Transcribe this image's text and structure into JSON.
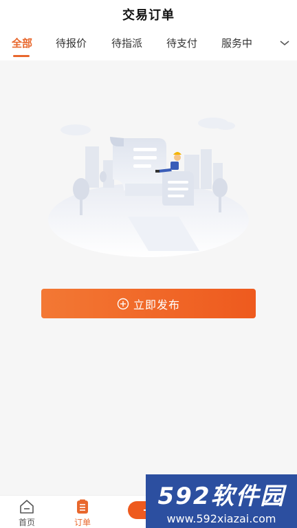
{
  "header": {
    "title": "交易订单"
  },
  "tabs": [
    {
      "label": "全部",
      "active": true
    },
    {
      "label": "待报价",
      "active": false
    },
    {
      "label": "待指派",
      "active": false
    },
    {
      "label": "待支付",
      "active": false
    },
    {
      "label": "服务中",
      "active": false
    }
  ],
  "tabs_more_icon": "chevron-down-icon",
  "empty_state": {
    "illustration": "empty-orders-illustration"
  },
  "publish_button": {
    "label": "立即发布",
    "icon": "plus-circle-icon"
  },
  "bottom_nav": [
    {
      "label": "首页",
      "icon": "home-icon",
      "active": false
    },
    {
      "label": "订单",
      "icon": "order-list-icon",
      "active": true
    }
  ],
  "watermark": {
    "logo": "592软件园",
    "url": "www.592xiazai.com"
  },
  "colors": {
    "accent": "#e8672c",
    "button": "#f06a28",
    "background": "#f6f6f6",
    "watermark": "#2c4fa0"
  }
}
